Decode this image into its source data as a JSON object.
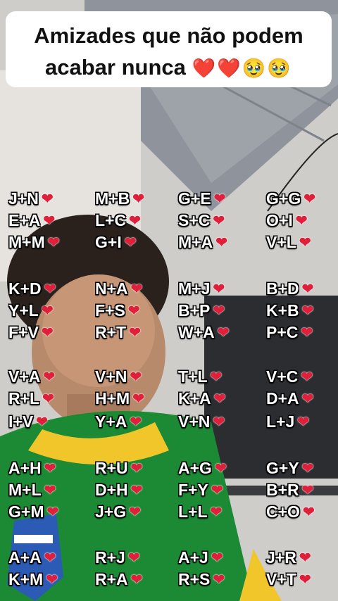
{
  "caption": {
    "line1": "Amizades que não podem",
    "line2_text": "acabar nunca",
    "line2_emojis": "❤️❤️🥹🥹"
  },
  "heart_glyph": "❤",
  "columns": [
    [
      "J+N",
      "E+A",
      "M+M",
      "K+D",
      "Y+L",
      "F+V",
      "V+A",
      "R+L",
      "I+V",
      "A+H",
      "M+L",
      "G+M",
      "A+A",
      "K+M"
    ],
    [
      "M+B",
      "L+C",
      "G+I",
      "N+A",
      "F+S",
      "R+T",
      "V+N",
      "H+M",
      "Y+A",
      "R+U",
      "D+H",
      "J+G",
      "R+J",
      "R+A"
    ],
    [
      "G+E",
      "S+C",
      "M+A",
      "M+J",
      "B+P",
      "W+A",
      "T+L",
      "K+A",
      "V+N",
      "A+G",
      "F+Y",
      "L+L",
      "A+J",
      "R+S"
    ],
    [
      "G+G",
      "O+I",
      "V+L",
      "B+D",
      "K+B",
      "P+C",
      "V+C",
      "D+A",
      "L+J",
      "G+Y",
      "B+R",
      "C+O",
      "J+R",
      "V+T"
    ]
  ]
}
